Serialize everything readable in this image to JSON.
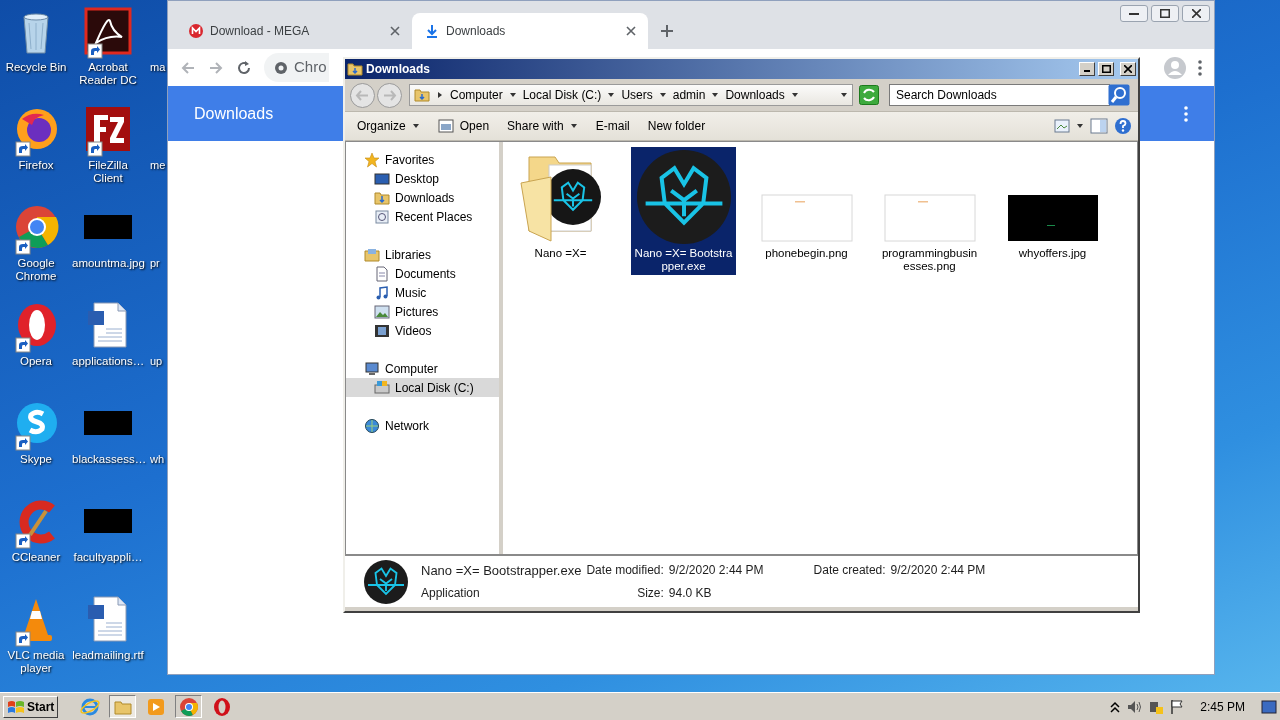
{
  "desktop": {
    "icons": [
      {
        "label": "Recycle Bin",
        "kind": "bin",
        "shortcut": false
      },
      {
        "label": "Firefox",
        "kind": "firefox",
        "shortcut": true
      },
      {
        "label": "Google Chrome",
        "kind": "chrome",
        "shortcut": true
      },
      {
        "label": "Opera",
        "kind": "opera",
        "shortcut": true
      },
      {
        "label": "Skype",
        "kind": "skype",
        "shortcut": true
      },
      {
        "label": "CCleaner",
        "kind": "ccleaner",
        "shortcut": true
      },
      {
        "label": "VLC media player",
        "kind": "vlc",
        "shortcut": true
      },
      {
        "label": "Acrobat Reader DC",
        "kind": "pdf",
        "shortcut": true
      },
      {
        "label": "FileZilla Client",
        "kind": "filezilla",
        "shortcut": true
      },
      {
        "label": "amountma.jpg",
        "kind": "image",
        "shortcut": false
      },
      {
        "label": "applications…",
        "kind": "word",
        "shortcut": false
      },
      {
        "label": "blackassess…",
        "kind": "image",
        "shortcut": false
      },
      {
        "label": "facultyappli…",
        "kind": "image",
        "shortcut": false
      },
      {
        "label": "leadmailing.rtf",
        "kind": "word",
        "shortcut": false
      },
      {
        "label": "ma",
        "kind": "cut"
      },
      {
        "label": "me",
        "kind": "cut"
      },
      {
        "label": "pr",
        "kind": "cut"
      },
      {
        "label": "up",
        "kind": "cut"
      },
      {
        "label": "wh",
        "kind": "cut"
      }
    ]
  },
  "browser": {
    "tabs": [
      {
        "title": "Download - MEGA",
        "kind": "mega",
        "selected": false
      },
      {
        "title": "Downloads",
        "kind": "download",
        "selected": true
      }
    ],
    "address": "Chro",
    "page_title": "Downloads"
  },
  "explorer": {
    "title": "Downloads",
    "breadcrumb": [
      "Computer",
      "Local Disk (C:)",
      "Users",
      "admin",
      "Downloads"
    ],
    "search": {
      "placeholder": "Search Downloads"
    },
    "toolbar": [
      {
        "label": "Organize",
        "kind": "menu"
      },
      {
        "label": "Open",
        "kind": "open"
      },
      {
        "label": "Share with",
        "kind": "menu"
      },
      {
        "label": "E-mail",
        "kind": "plain"
      },
      {
        "label": "New folder",
        "kind": "plain"
      }
    ],
    "nav": [
      {
        "label": "Favorites",
        "kind": "star",
        "selected": false,
        "children": [
          {
            "label": "Desktop",
            "kind": "desktop",
            "selected": false
          },
          {
            "label": "Downloads",
            "kind": "downloads",
            "selected": false
          },
          {
            "label": "Recent Places",
            "kind": "recent",
            "selected": false
          }
        ]
      },
      {
        "label": "Libraries",
        "kind": "library",
        "selected": false,
        "children": [
          {
            "label": "Documents",
            "kind": "documents",
            "selected": false
          },
          {
            "label": "Music",
            "kind": "music",
            "selected": false
          },
          {
            "label": "Pictures",
            "kind": "pictures",
            "selected": false
          },
          {
            "label": "Videos",
            "kind": "videos",
            "selected": false
          }
        ]
      },
      {
        "label": "Computer",
        "kind": "computer",
        "selected": false,
        "children": [
          {
            "label": "Local Disk (C:)",
            "kind": "disk",
            "selected": true
          }
        ]
      },
      {
        "label": "Network",
        "kind": "network",
        "selected": false
      }
    ],
    "files": [
      {
        "name": "Nano =X=",
        "kind": "folder",
        "selected": false
      },
      {
        "name": "Nano =X= Bootstrapper.exe",
        "kind": "app",
        "selected": true
      },
      {
        "name": "phonebegin.png",
        "kind": "light_image",
        "selected": false
      },
      {
        "name": "programmingbusinesses.png",
        "kind": "light_image",
        "selected": false
      },
      {
        "name": "whyoffers.jpg",
        "kind": "dark_image",
        "selected": false
      }
    ],
    "details": {
      "name": "Nano =X= Bootstrapper.exe",
      "type": "Application",
      "fields": [
        {
          "label": "Date modified:",
          "value": "9/2/2020 2:44 PM"
        },
        {
          "label": "Date created:",
          "value": "9/2/2020 2:44 PM"
        },
        {
          "label": "Size:",
          "value": "94.0 KB"
        }
      ]
    }
  },
  "taskbar": {
    "start": "Start",
    "items": [
      {
        "kind": "ie",
        "open": false,
        "selected": false
      },
      {
        "kind": "explorer",
        "open": true,
        "selected": true
      },
      {
        "kind": "media",
        "open": false,
        "selected": false
      },
      {
        "kind": "chrome",
        "open": true,
        "selected": false
      },
      {
        "kind": "opera",
        "open": false,
        "selected": false
      }
    ],
    "clock": "2:45 PM"
  }
}
